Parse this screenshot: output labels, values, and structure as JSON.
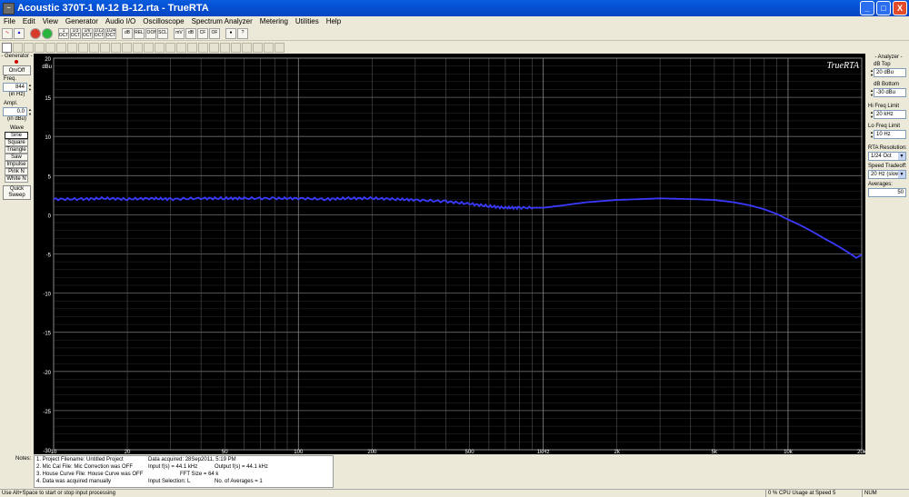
{
  "window": {
    "title": "Acoustic 370T-1 M-12 B-12.rta - TrueRTA",
    "buttons": [
      "_",
      "□",
      "X"
    ]
  },
  "menu": [
    "File",
    "Edit",
    "View",
    "Generator",
    "Audio I/O",
    "Oscilloscope",
    "Spectrum Analyzer",
    "Metering",
    "Utilities",
    "Help"
  ],
  "toolbar": {
    "buttons": [
      "1 OCT",
      "1/3 OCT",
      "1/6 OCT",
      "1/12 OCT",
      "1/24 OCT",
      "dB",
      "REL",
      "ZOOM",
      "SCL",
      "mV",
      "dB",
      "CF",
      "OF",
      "?"
    ]
  },
  "generator": {
    "group_label": "- Generator -",
    "onoff_label": "On/Off",
    "freq_label": "Freq.",
    "freq_value": "844",
    "freq_unit": "(in Hz)",
    "ampl_label": "Ampl.",
    "ampl_value": "0.0",
    "ampl_unit": "(in dBu)",
    "wave_label": "Wave",
    "waves": [
      "Sine",
      "Square",
      "Triangle",
      "Saw",
      "Impulse",
      "Pink N",
      "White N"
    ],
    "quick_sweep": "Quick Sweep"
  },
  "analyzer": {
    "group_label": "- Analyzer -",
    "db_top_label": "dB Top",
    "db_top_value": "20 dBu",
    "db_bottom_label": "dB Bottom",
    "db_bottom_value": "-30 dBu",
    "hi_freq_label": "Hi Freq Limit",
    "hi_freq_value": "20 kHz",
    "lo_freq_label": "Lo Freq Limit",
    "lo_freq_value": "10 Hz",
    "resolution_label": "RTA Resolution:",
    "resolution_value": "1/24 Oct",
    "speed_label": "Speed Tradeoff:",
    "speed_value": "20 Hz (slow)",
    "averages_label": "Averages:",
    "averages_value": "50"
  },
  "colors": {
    "plot_bg": "#000000",
    "grid": "#5a5a5a",
    "trace": "#3a3aff",
    "titlebar": "#0a5ddf"
  },
  "chart_data": {
    "type": "line",
    "logo": "TrueRTA",
    "ylabel": "dBu",
    "ylim": [
      -30,
      20
    ],
    "xlim": [
      10,
      20000
    ],
    "xscale": "log",
    "y_ticks": [
      "20",
      "15",
      "10",
      "5",
      "0",
      "-5",
      "-10",
      "-15",
      "-20",
      "-25",
      "-30"
    ],
    "x_ticks": [
      {
        "v": 10,
        "label": "10"
      },
      {
        "v": 20,
        "label": "20"
      },
      {
        "v": 50,
        "label": "50"
      },
      {
        "v": 100,
        "label": "100"
      },
      {
        "v": 200,
        "label": "200"
      },
      {
        "v": 500,
        "label": "500"
      },
      {
        "v": 1000,
        "label": "1kHz"
      },
      {
        "v": 2000,
        "label": "2k"
      },
      {
        "v": 5000,
        "label": "5k"
      },
      {
        "v": 10000,
        "label": "10k"
      },
      {
        "v": 20000,
        "label": "20k"
      }
    ],
    "grid": true,
    "series": [
      {
        "x": [
          10,
          13,
          16,
          20,
          25,
          30,
          40,
          50,
          60,
          80,
          100,
          130,
          160,
          200,
          250,
          300,
          400,
          500,
          600,
          700,
          800,
          1000,
          1200,
          1500,
          2000,
          2500,
          3000,
          4000,
          5000,
          6000,
          7000,
          8000,
          9000,
          10000,
          11000,
          12000,
          13000,
          14000,
          15000,
          16000,
          17000,
          18000,
          19000,
          20000
        ],
        "y": [
          2.0,
          2.0,
          2.1,
          2.0,
          2.1,
          2.0,
          2.1,
          2.1,
          2.1,
          2.1,
          2.1,
          2.0,
          2.1,
          2.1,
          2.0,
          1.9,
          1.7,
          1.4,
          1.1,
          0.9,
          0.9,
          0.9,
          1.2,
          1.6,
          1.9,
          2.0,
          2.1,
          2.0,
          1.9,
          1.6,
          1.2,
          0.7,
          0.1,
          -0.6,
          -1.2,
          -1.8,
          -2.4,
          -3.0,
          -3.5,
          -4.0,
          -4.5,
          -5.0,
          -5.5,
          -5.1
        ]
      }
    ]
  },
  "info": {
    "notes_label": "Notes:",
    "line1_a": "1. Project Filename: Untitled Project",
    "line1_b": "Data acquired: 28Sep2011, 5:19 PM",
    "line2_a": "2. Mic Cal File: Mic Correction was OFF",
    "line2_b": "Input f(s) = 44.1 kHz",
    "line2_c": "Output f(s) = 44.1 kHz",
    "line3_a": "3. House Curve File: House Curve was OFF",
    "line3_b": "FFT Size = 64 k",
    "line4_a": "4. Data was acquired manually",
    "line4_b": "Input Selection: L",
    "line4_c": "No. of Averages = 1"
  },
  "status": {
    "hint": "Use Alt+Space to start or stop input processing",
    "cpu": "0 % CPU Usage at Speed 5",
    "num": "NUM"
  }
}
